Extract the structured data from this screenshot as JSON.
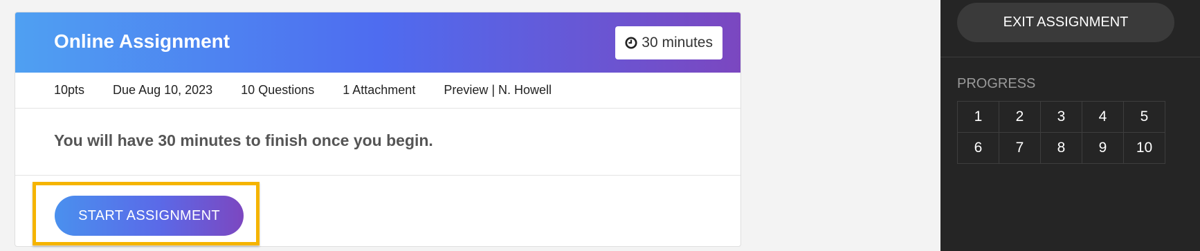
{
  "card": {
    "title": "Online Assignment",
    "timer": "30 minutes",
    "timer_icon": "clock-icon",
    "meta": [
      "10pts",
      "Due Aug 10, 2023",
      "10 Questions",
      "1 Attachment",
      "Preview | N. Howell"
    ],
    "notice": "You will have 30 minutes to finish once you begin.",
    "start_label": "START ASSIGNMENT"
  },
  "side": {
    "exit_label": "EXIT ASSIGNMENT",
    "progress_label": "PROGRESS",
    "questions": [
      "1",
      "2",
      "3",
      "4",
      "5",
      "6",
      "7",
      "8",
      "9",
      "10"
    ]
  },
  "colors": {
    "header_gradient": [
      "#4fa0f2",
      "#4e6cf0",
      "#7b47c0"
    ],
    "highlight": "#f5b400",
    "panel_bg": "#252525"
  }
}
